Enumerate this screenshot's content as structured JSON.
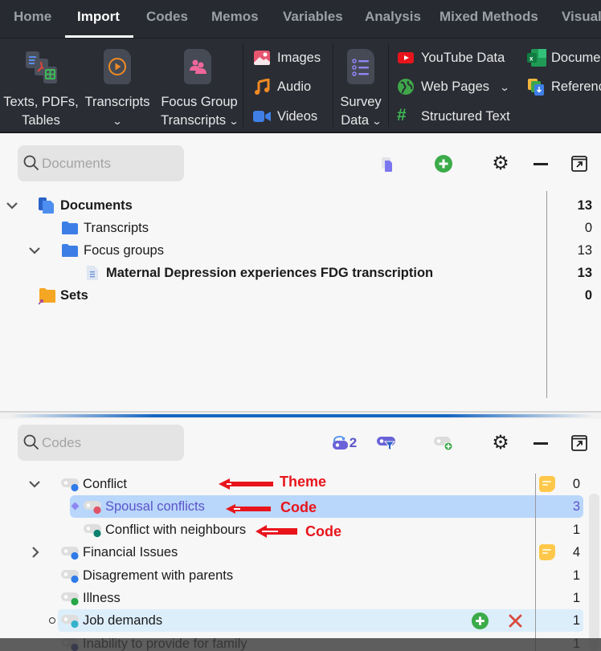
{
  "menubar": {
    "tabs": [
      {
        "label": "Home",
        "active": false
      },
      {
        "label": "Import",
        "active": true
      },
      {
        "label": "Codes",
        "active": false
      },
      {
        "label": "Memos",
        "active": false
      },
      {
        "label": "Variables",
        "active": false
      },
      {
        "label": "Analysis",
        "active": false
      },
      {
        "label": "Mixed Methods",
        "active": false
      },
      {
        "label": "Visual",
        "active": false
      }
    ]
  },
  "ribbon": {
    "texts_pdfs_tables": {
      "line1": "Texts, PDFs,",
      "line2": "Tables",
      "icon": "texts-pdfs-tables-icon"
    },
    "transcripts": {
      "line1": "Transcripts",
      "has_dropdown": true,
      "icon": "transcript-play-icon"
    },
    "focus_group": {
      "line1": "Focus Group",
      "line2": "Transcripts",
      "has_dropdown": true,
      "icon": "focus-group-icon"
    },
    "images": {
      "label": "Images",
      "icon": "image-icon"
    },
    "audio": {
      "label": "Audio",
      "icon": "music-note-icon"
    },
    "videos": {
      "label": "Videos",
      "icon": "video-camera-icon"
    },
    "survey": {
      "line1": "Survey",
      "line2": "Data",
      "has_dropdown": true,
      "icon": "survey-list-icon"
    },
    "youtube": {
      "label": "YouTube Data",
      "icon": "youtube-icon"
    },
    "web_pages": {
      "label": "Web Pages",
      "has_dropdown": true,
      "icon": "globe-icon"
    },
    "structured_text": {
      "label": "Structured Text",
      "icon": "hash-icon"
    },
    "document_table": {
      "label": "Docume",
      "icon": "excel-icon"
    },
    "references": {
      "label": "Referenc",
      "icon": "references-icon"
    }
  },
  "documents_pane": {
    "search_placeholder": "Documents",
    "toolbar": [
      "new-document-icon",
      "add-icon",
      "gear-icon",
      "minimize-icon",
      "undock-icon"
    ],
    "tree": [
      {
        "label": "Documents",
        "count": "13",
        "bold": true,
        "expanded": true,
        "level": 0,
        "icon": "documents-stack-icon"
      },
      {
        "label": "Transcripts",
        "count": "0",
        "bold": false,
        "level": 1,
        "icon": "folder-icon"
      },
      {
        "label": "Focus groups",
        "count": "13",
        "bold": false,
        "expanded": true,
        "level": 1,
        "icon": "folder-icon"
      },
      {
        "label": "Maternal Depression experiences FDG transcription",
        "count": "13",
        "bold": true,
        "level": 2,
        "icon": "text-document-icon"
      },
      {
        "label": "Sets",
        "count": "0",
        "bold": true,
        "level": 0,
        "icon": "sets-folder-icon"
      }
    ]
  },
  "codes_pane": {
    "search_placeholder": "Codes",
    "toolbar": {
      "activated_codes_count": "2",
      "items": [
        "activated-codes-icon",
        "code-filter-icon",
        "new-code-icon",
        "gear-icon",
        "minimize-icon",
        "undock-icon"
      ]
    },
    "tree": [
      {
        "label": "Conflict",
        "count": "0",
        "color": "#2f7be8",
        "expanded": true,
        "level": 0,
        "memo": true,
        "selected": false
      },
      {
        "label": "Spousal conflicts",
        "count": "3",
        "color": "#e05468",
        "level": 1,
        "memo": false,
        "selected": true
      },
      {
        "label": "Conflict with neighbours",
        "count": "1",
        "color": "#0e8070",
        "level": 1,
        "memo": false,
        "selected": false
      },
      {
        "label": "Financial Issues",
        "count": "4",
        "color": "#2f7be8",
        "expanded": false,
        "level": 0,
        "memo": true,
        "selected": false
      },
      {
        "label": "Disagrement with parents",
        "count": "1",
        "color": "#2f7be8",
        "level": 0,
        "memo": false,
        "selected": false
      },
      {
        "label": "Illness",
        "count": "1",
        "color": "#27a848",
        "level": 0,
        "memo": false,
        "selected": false
      },
      {
        "label": "Job demands",
        "count": "1",
        "color": "#35b2cc",
        "level": 0,
        "memo": false,
        "selected": false,
        "hovered": true
      },
      {
        "label": "Inability to provide for family",
        "count": "1",
        "color": "#2b3a9c",
        "level": 0,
        "memo": false,
        "selected": false
      }
    ],
    "hover_actions": [
      "add-icon",
      "delete-icon"
    ]
  },
  "annotations": [
    {
      "label": "Theme",
      "color": "#e8141c"
    },
    {
      "label": "Code",
      "color": "#e8141c"
    },
    {
      "label": "Code",
      "color": "#e8141c"
    }
  ],
  "colors": {
    "menubar_bg": "#272a30",
    "ribbon_bg": "#2a2d34",
    "selection_bg": "#b9d6fb",
    "hover_bg": "#ddeefb",
    "accent_blue": "#1565c0",
    "add_green": "#3cab4a",
    "delete_red": "#d94a3e"
  }
}
